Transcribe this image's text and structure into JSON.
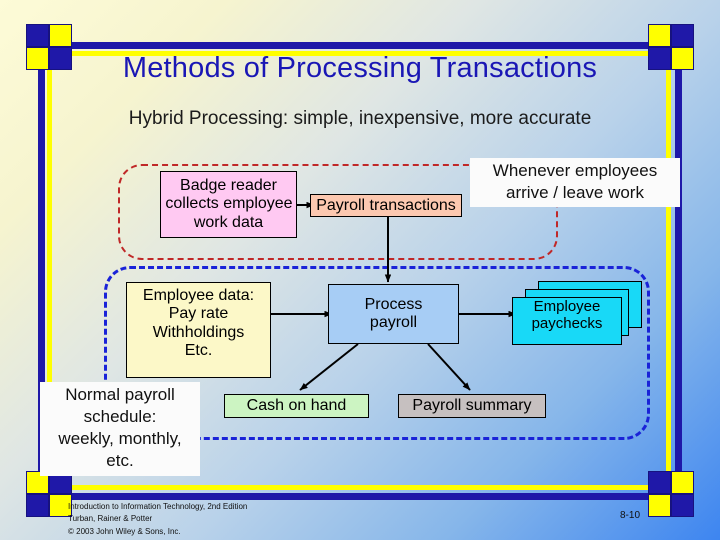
{
  "slide": {
    "title": "Methods of Processing Transactions",
    "subtitle": "Hybrid Processing: simple, inexpensive, more accurate",
    "page_number": "8-10",
    "title_color": "#1a17b5",
    "frame_colors": {
      "blue": "#1f18a8",
      "yellow": "#ffff00"
    }
  },
  "diagram": {
    "zones": [
      {
        "name": "real-time-zone",
        "style": "red-dashed-rounded",
        "color": "#c02828"
      },
      {
        "name": "batch-zone",
        "style": "blue-dashed-rounded",
        "color": "#1a23d8"
      }
    ],
    "nodes": {
      "badge_reader": {
        "line1": "Badge reader",
        "line2": "collects employee",
        "line3": "work data",
        "color": "#ffc9f2"
      },
      "payroll_transactions": {
        "label": "Payroll transactions",
        "color": "#fcc8b0"
      },
      "employee_data": {
        "line1": "Employee data:",
        "line2": "Pay rate",
        "line3": "Withholdings",
        "line4": "Etc.",
        "color": "#fcf8c8"
      },
      "process_payroll": {
        "line1": "Process",
        "line2": "payroll",
        "color": "#a7cdf5"
      },
      "employee_paychecks": {
        "line1": "Employee",
        "line2": "paychecks",
        "color": "#18d9f7"
      },
      "cash_on_hand": {
        "label": "Cash on hand",
        "color": "#ccf4c2"
      },
      "payroll_summary": {
        "label": "Payroll summary",
        "color": "#c6c0c0"
      }
    },
    "callouts": {
      "whenever": {
        "line1": "Whenever employees",
        "line2": "arrive / leave work"
      },
      "schedule": {
        "line1": "Normal payroll",
        "line2": "schedule:",
        "line3": "weekly, monthly,",
        "line4": "etc."
      }
    }
  },
  "footer": {
    "line1": "Introduction  to Information  Technology, 2nd Edition",
    "line2": "Turban, Rainer & Potter",
    "line3": "© 2003 John Wiley & Sons, Inc."
  }
}
